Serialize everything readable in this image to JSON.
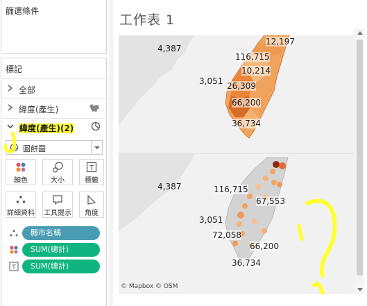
{
  "filters": {
    "title": "篩選條件"
  },
  "marks": {
    "title": "標記",
    "rows": [
      {
        "label": "全部"
      },
      {
        "label": "緯度(產生)"
      },
      {
        "label": "緯度(產生)(2)"
      }
    ],
    "mark_type": "圓餅圖",
    "buttons": [
      "顏色",
      "大小",
      "標籤",
      "詳細資料",
      "工具提示",
      "角度"
    ],
    "pills": [
      "縣市名稱",
      "SUM(總計)",
      "SUM(總計)"
    ]
  },
  "sheet": {
    "title": "工作表 1"
  },
  "map": {
    "top_labels": [
      "12,197",
      "4,387",
      "116,715",
      "10,214",
      "3,051",
      "26,309",
      "66,200",
      "36,734"
    ],
    "bottom_labels": [
      "4,387",
      "116,715",
      "67,553",
      "3,051",
      "72,058",
      "66,200",
      "36,734"
    ],
    "attribution": "© Mapbox © OSM"
  },
  "colors": {
    "pill_blue": "#4a9cb4",
    "pill_green": "#10b47e",
    "highlight": "#ffff33",
    "map_orange": "#f0913a"
  }
}
